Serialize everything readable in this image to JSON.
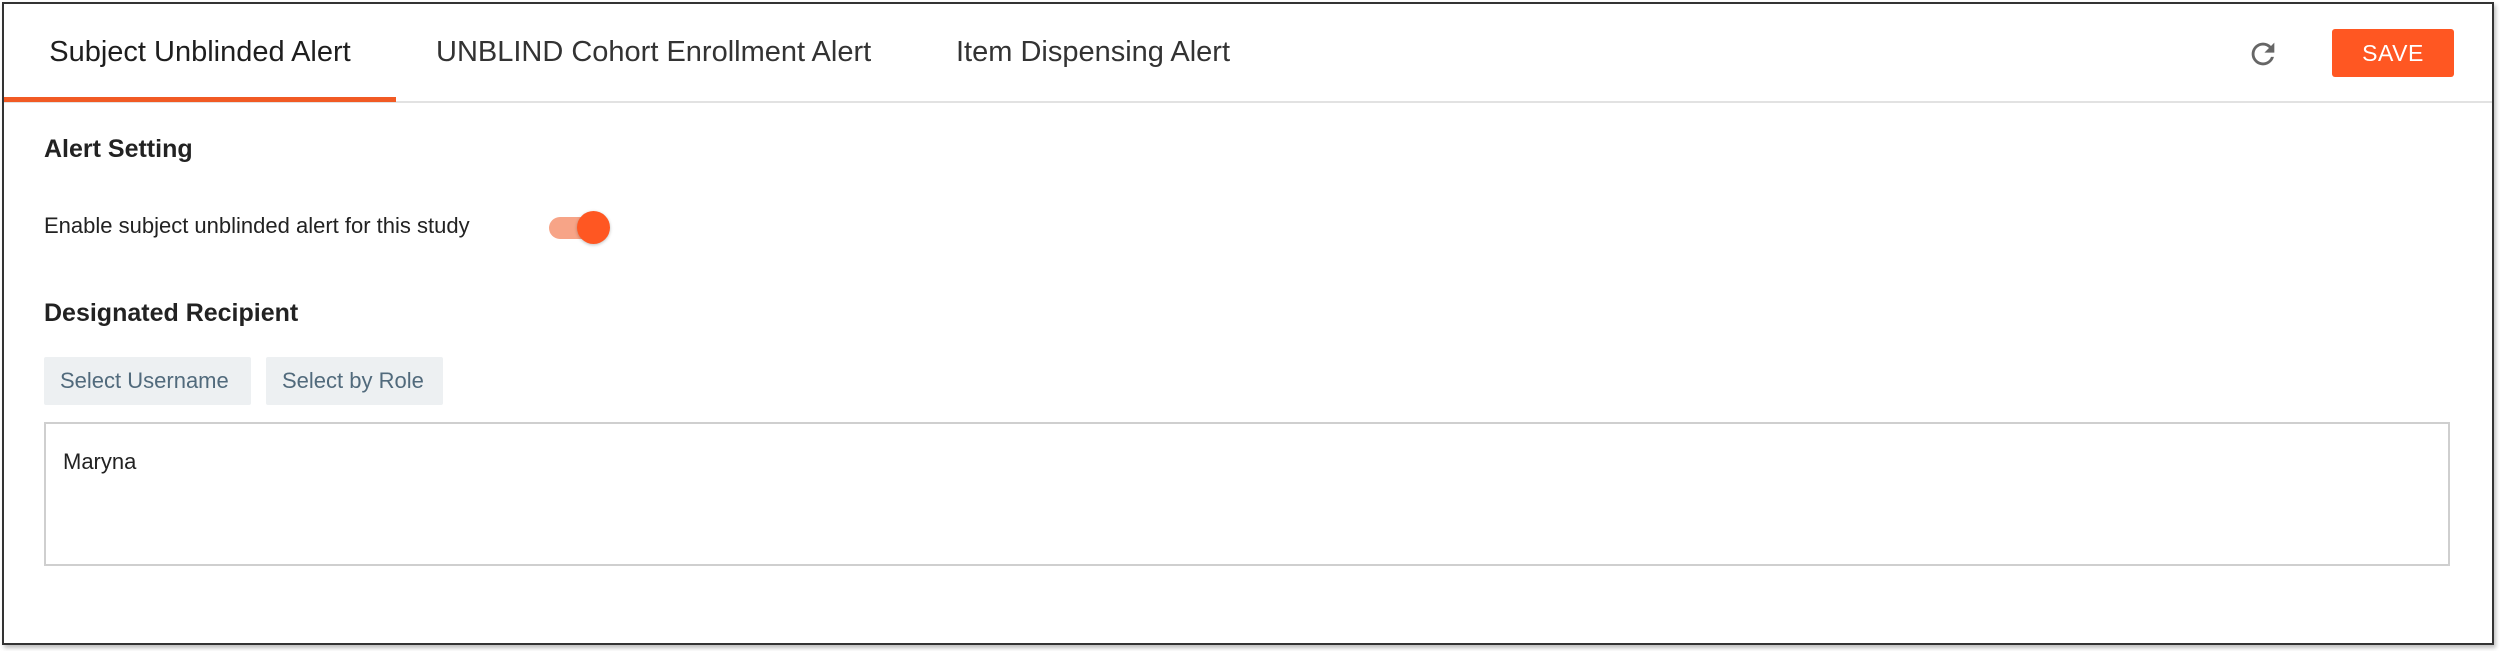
{
  "tabs": [
    {
      "label": "Subject Unblinded Alert",
      "active": true
    },
    {
      "label": "UNBLIND Cohort Enrollment Alert",
      "active": false
    },
    {
      "label": "Item Dispensing Alert",
      "active": false
    }
  ],
  "toolbar": {
    "refresh_icon": "refresh-icon",
    "save_label": "SAVE"
  },
  "alert_setting": {
    "title": "Alert Setting",
    "toggle_label": "Enable subject unblinded alert for this study",
    "toggle_on": true
  },
  "recipient": {
    "title": "Designated Recipient",
    "select_username_label": "Select Username",
    "select_role_label": "Select by Role",
    "value": "Maryna"
  },
  "colors": {
    "accent": "#ff5722",
    "toggle_track": "#f7a487",
    "secondary_button_bg": "#edf0f2",
    "secondary_button_text": "#516a7c"
  }
}
